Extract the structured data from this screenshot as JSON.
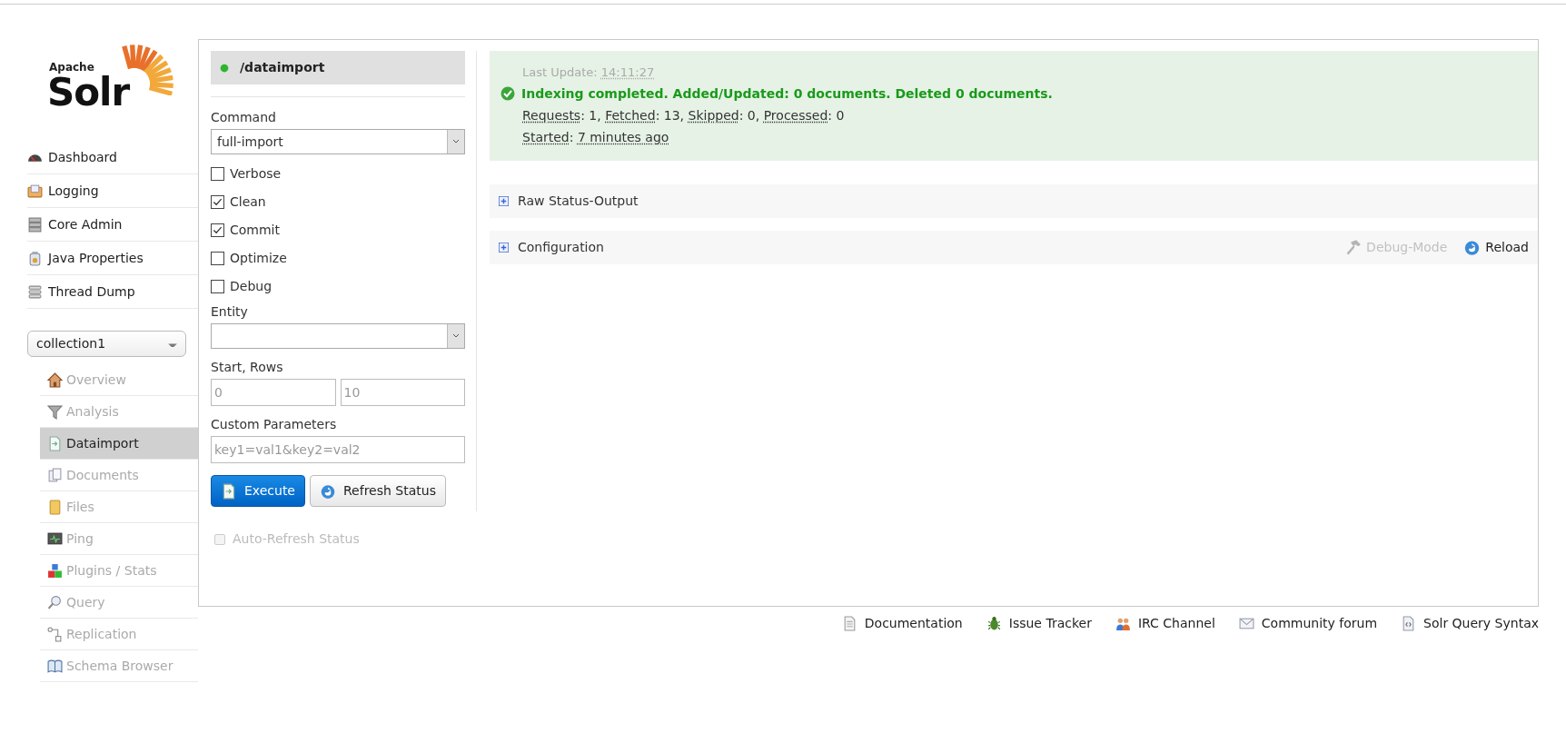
{
  "logo": {
    "small": "Apache",
    "big": "Solr"
  },
  "main_nav": [
    {
      "label": "Dashboard"
    },
    {
      "label": "Logging"
    },
    {
      "label": "Core Admin"
    },
    {
      "label": "Java Properties"
    },
    {
      "label": "Thread Dump"
    }
  ],
  "core_selector": {
    "value": "collection1"
  },
  "core_nav": [
    {
      "label": "Overview",
      "selected": false
    },
    {
      "label": "Analysis",
      "selected": false
    },
    {
      "label": "Dataimport",
      "selected": true
    },
    {
      "label": "Documents",
      "selected": false
    },
    {
      "label": "Files",
      "selected": false
    },
    {
      "label": "Ping",
      "selected": false
    },
    {
      "label": "Plugins / Stats",
      "selected": false
    },
    {
      "label": "Query",
      "selected": false
    },
    {
      "label": "Replication",
      "selected": false
    },
    {
      "label": "Schema Browser",
      "selected": false
    }
  ],
  "handler": {
    "name": "/dataimport"
  },
  "form": {
    "command_label": "Command",
    "command": "full-import",
    "options": [
      {
        "label": "Verbose",
        "checked": false
      },
      {
        "label": "Clean",
        "checked": true
      },
      {
        "label": "Commit",
        "checked": true
      },
      {
        "label": "Optimize",
        "checked": false
      },
      {
        "label": "Debug",
        "checked": false
      }
    ],
    "entity_label": "Entity",
    "start_rows_label": "Start, Rows",
    "start_placeholder": "0",
    "rows_placeholder": "10",
    "custom_label": "Custom Parameters",
    "custom_placeholder": "key1=val1&key2=val2",
    "buttons": [
      {
        "label": "Execute",
        "kind": "primary"
      },
      {
        "label": "Refresh Status",
        "kind": "secondary"
      }
    ],
    "auto_refresh": {
      "label": "Auto-Refresh Status",
      "checked": false,
      "disabled": true
    }
  },
  "status": {
    "last_update": [
      {
        "text": "Last Update: ",
        "abbr": false
      },
      {
        "text": "14:11:27",
        "abbr": true
      }
    ],
    "message": "Indexing completed. Added/Updated: 0 documents. Deleted 0 documents.",
    "stats": [
      {
        "text": "Requests",
        "abbr": true
      },
      {
        "text": ": 1, ",
        "abbr": false
      },
      {
        "text": "Fetched",
        "abbr": true
      },
      {
        "text": ": 13, ",
        "abbr": false
      },
      {
        "text": "Skipped",
        "abbr": true
      },
      {
        "text": ": 0, ",
        "abbr": false
      },
      {
        "text": "Processed",
        "abbr": true
      },
      {
        "text": ": 0",
        "abbr": false
      }
    ],
    "started": [
      {
        "text": "Started",
        "abbr": true
      },
      {
        "text": ": ",
        "abbr": false
      },
      {
        "text": "7 minutes ago",
        "abbr": true
      }
    ]
  },
  "sections": [
    {
      "title": "Raw Status-Output",
      "expanded": false
    },
    {
      "title": "Configuration",
      "expanded": false,
      "actions": [
        {
          "label": "Debug-Mode",
          "disabled": true
        },
        {
          "label": "Reload",
          "disabled": false
        }
      ]
    }
  ],
  "footer": [
    {
      "label": "Documentation"
    },
    {
      "label": "Issue Tracker"
    },
    {
      "label": "IRC Channel"
    },
    {
      "label": "Community forum"
    },
    {
      "label": "Solr Query Syntax"
    }
  ]
}
